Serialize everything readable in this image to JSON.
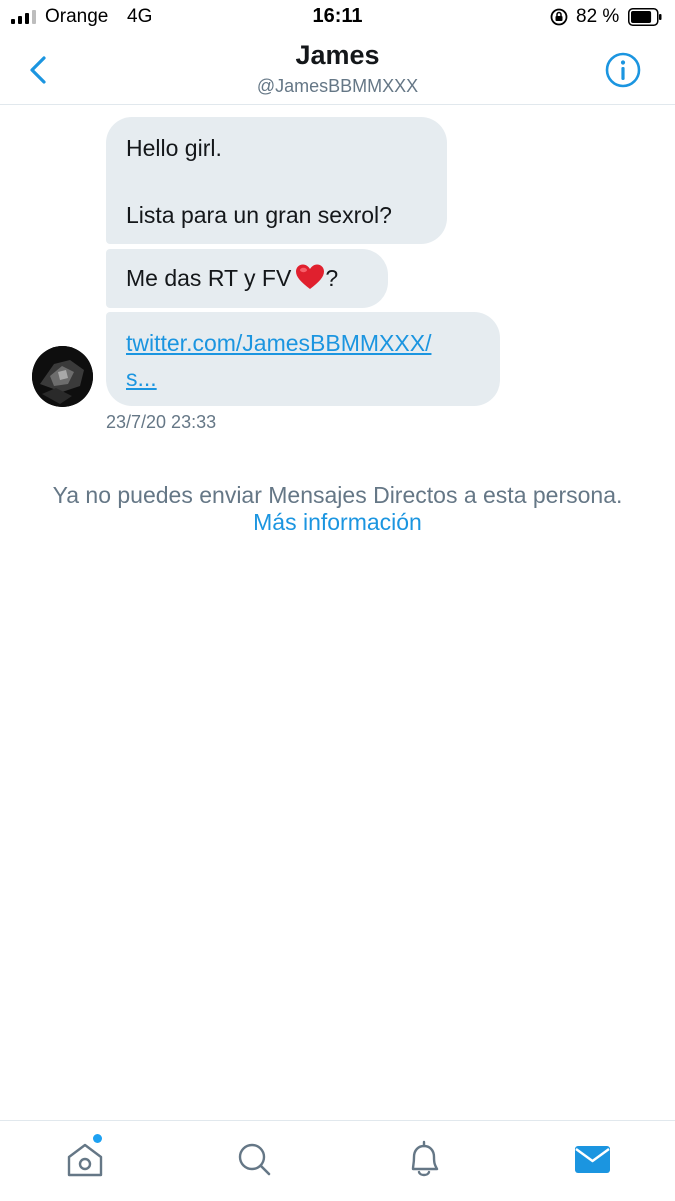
{
  "status_bar": {
    "carrier": "Orange",
    "network": "4G",
    "time": "16:11",
    "battery_percent": "82 %",
    "battery_level": 0.82,
    "signal_bars_filled": 3,
    "signal_bars_total": 4
  },
  "header": {
    "title": "James",
    "handle": "@JamesBBMMXXX",
    "back_icon": "chevron-left-icon",
    "info_icon": "info-icon"
  },
  "conversation": {
    "messages": [
      {
        "lines": [
          "Hello girl.",
          "Lista para un gran sexrol?"
        ]
      },
      {
        "text": "Me das RT y FV",
        "emoji": "heart",
        "suffix": "?"
      },
      {
        "link_lines": [
          "twitter.com/JamesBBMMXXX/",
          "s..."
        ]
      }
    ],
    "timestamp": "23/7/20 23:33"
  },
  "notice": {
    "text": "Ya no puedes enviar Mensajes Directos a esta persona.",
    "link": "Más información"
  },
  "tab_bar": {
    "items": [
      {
        "name": "home",
        "icon": "home-icon",
        "has_badge": true
      },
      {
        "name": "search",
        "icon": "search-icon",
        "has_badge": false
      },
      {
        "name": "notifications",
        "icon": "bell-icon",
        "has_badge": false
      },
      {
        "name": "messages",
        "icon": "mail-icon",
        "active": true
      }
    ]
  },
  "colors": {
    "accent": "#1b95e0",
    "bubble": "#e6ecf0",
    "secondary_text": "#657786",
    "divider": "#e1e8ed"
  }
}
